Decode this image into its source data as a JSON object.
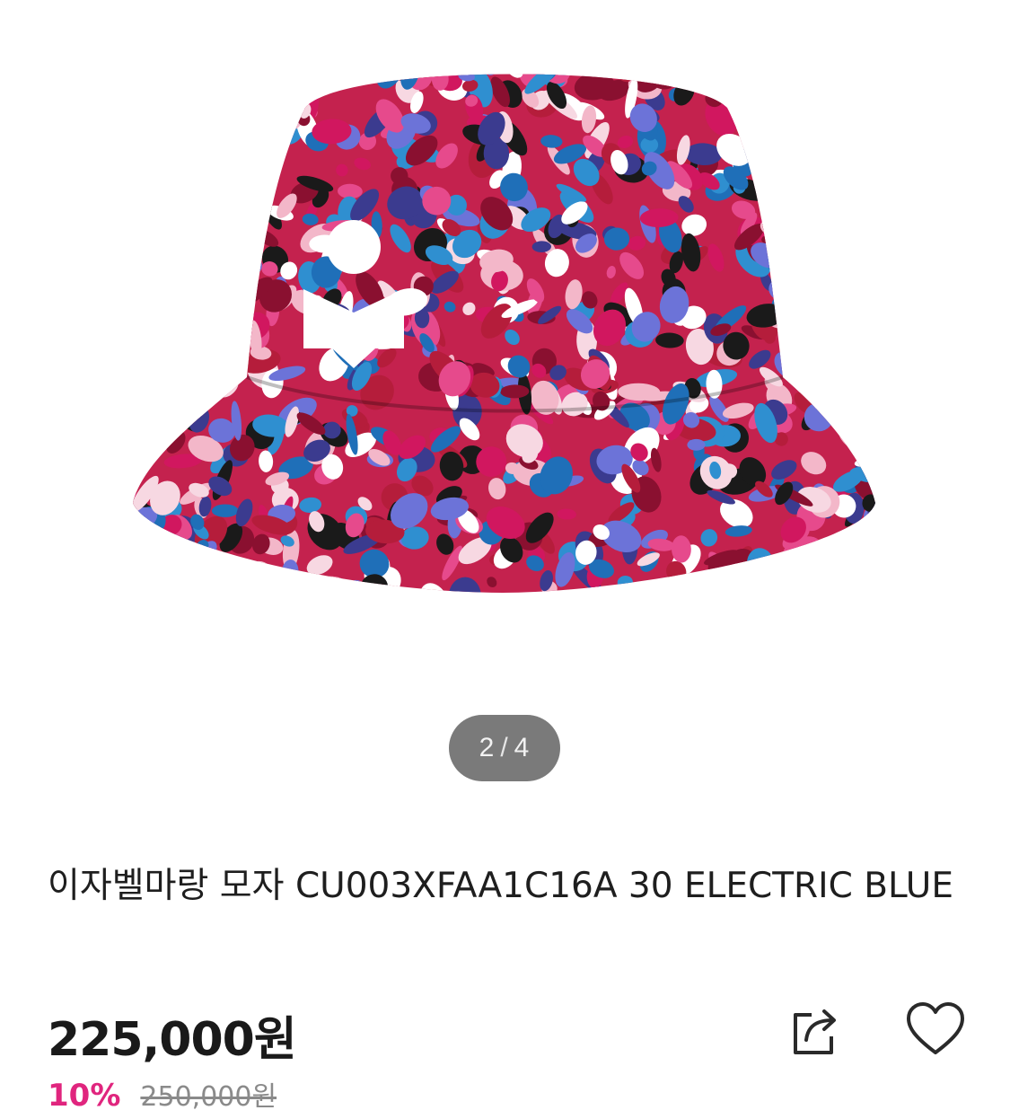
{
  "gallery": {
    "current": "2",
    "separator": "/",
    "total": "4",
    "image_alt": "Isabel Marant bucket hat"
  },
  "product": {
    "title": "이자벨마랑 모자 CU003XFAA1C16A 30 ELECTRIC BLUE",
    "price": "225,000원",
    "discount": "10%",
    "original_price": "250,000원"
  },
  "actions": {
    "share_icon": "share-icon",
    "wishlist_icon": "heart-icon"
  },
  "colors": {
    "discount": "#e0257e",
    "badge_bg": "#7a7a7a"
  }
}
